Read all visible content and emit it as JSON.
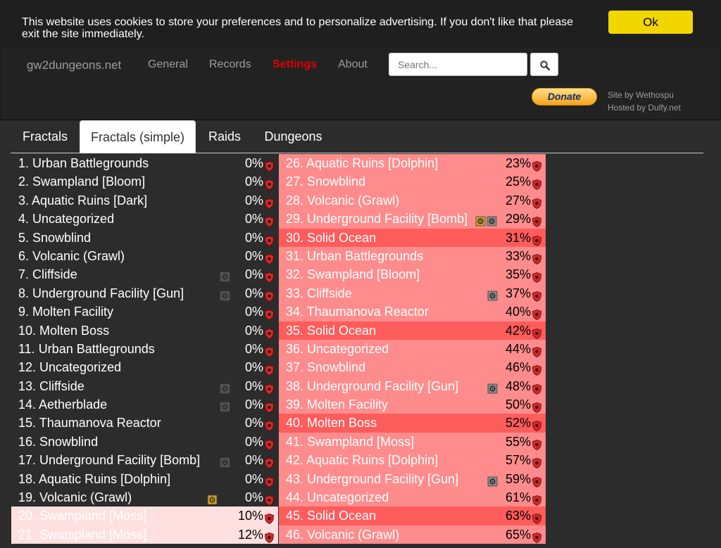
{
  "cookie": {
    "message": "This website uses cookies to store your preferences and to personalize advertising. If you don't like that please exit the site immediately.",
    "ok_label": "Ok"
  },
  "nav": {
    "brand": "gw2dungeons.net",
    "links": [
      "General",
      "Records",
      "Settings",
      "About"
    ],
    "active_link": "Settings",
    "search_placeholder": "Search...",
    "donate_label": "Donate",
    "credit_site": "Site by Wethospu",
    "credit_host": "Hosted by Dulfy.net"
  },
  "tabs": [
    "Fractals",
    "Fractals (simple)",
    "Raids",
    "Dungeons"
  ],
  "active_tab": "Fractals (simple)",
  "colors": {
    "dark_row": "#2c2c2c",
    "light_row": "#ff8c8c",
    "highlight_row": "#ff5c5c",
    "pale_row": "#ffe0e0",
    "shield": "#d42a2a"
  },
  "left_column": [
    {
      "name": "1. Urban Battlegrounds",
      "pct": "0%",
      "style": "dark",
      "icon": ""
    },
    {
      "name": "2. Swampland [Bloom]",
      "pct": "0%",
      "style": "dark",
      "icon": ""
    },
    {
      "name": "3. Aquatic Ruins [Dark]",
      "pct": "0%",
      "style": "dark",
      "icon": ""
    },
    {
      "name": "4. Uncategorized",
      "pct": "0%",
      "style": "dark",
      "icon": ""
    },
    {
      "name": "5. Snowblind",
      "pct": "0%",
      "style": "dark",
      "icon": ""
    },
    {
      "name": "6. Volcanic (Grawl)",
      "pct": "0%",
      "style": "dark",
      "icon": ""
    },
    {
      "name": "7. Cliffside",
      "pct": "0%",
      "style": "dark",
      "icon": "gear-icon"
    },
    {
      "name": "8. Underground Facility [Gun]",
      "pct": "0%",
      "style": "dark",
      "icon": "gear-icon"
    },
    {
      "name": "9. Molten Facility",
      "pct": "0%",
      "style": "dark",
      "icon": ""
    },
    {
      "name": "10. Molten Boss",
      "pct": "0%",
      "style": "dark",
      "icon": ""
    },
    {
      "name": "11. Urban Battlegrounds",
      "pct": "0%",
      "style": "dark",
      "icon": ""
    },
    {
      "name": "12. Uncategorized",
      "pct": "0%",
      "style": "dark",
      "icon": ""
    },
    {
      "name": "13. Cliffside",
      "pct": "0%",
      "style": "dark",
      "icon": "gear-icon"
    },
    {
      "name": "14. Aetherblade",
      "pct": "0%",
      "style": "dark",
      "icon": "gear-icon"
    },
    {
      "name": "15. Thaumanova Reactor",
      "pct": "0%",
      "style": "dark",
      "icon": ""
    },
    {
      "name": "16. Snowblind",
      "pct": "0%",
      "style": "dark",
      "icon": ""
    },
    {
      "name": "17. Underground Facility [Bomb]",
      "pct": "0%",
      "style": "dark",
      "icon": "gear-icon"
    },
    {
      "name": "18. Aquatic Ruins [Dolphin]",
      "pct": "0%",
      "style": "dark",
      "icon": ""
    },
    {
      "name": "19. Volcanic (Grawl)",
      "pct": "0%",
      "style": "dark",
      "icon": "gold-icon"
    },
    {
      "name": "20. Swampland [Moss]",
      "pct": "10%",
      "style": "pale",
      "icon": ""
    },
    {
      "name": "21. Swampland [Moss]",
      "pct": "12%",
      "style": "pale",
      "icon": ""
    }
  ],
  "right_column": [
    {
      "name": "26. Aquatic Ruins [Dolphin]",
      "pct": "23%",
      "style": "light",
      "icon": ""
    },
    {
      "name": "27. Snowblind",
      "pct": "25%",
      "style": "light",
      "icon": ""
    },
    {
      "name": "28. Volcanic (Grawl)",
      "pct": "27%",
      "style": "light",
      "icon": ""
    },
    {
      "name": "29. Underground Facility [Bomb]",
      "pct": "29%",
      "style": "light",
      "icon": "gold-gear-icon"
    },
    {
      "name": "30. Solid Ocean",
      "pct": "31%",
      "style": "highlight",
      "icon": ""
    },
    {
      "name": "31. Urban Battlegrounds",
      "pct": "33%",
      "style": "light",
      "icon": ""
    },
    {
      "name": "32. Swampland [Bloom]",
      "pct": "35%",
      "style": "light",
      "icon": ""
    },
    {
      "name": "33. Cliffside",
      "pct": "37%",
      "style": "light",
      "icon": "gear-icon"
    },
    {
      "name": "34. Thaumanova Reactor",
      "pct": "40%",
      "style": "light",
      "icon": ""
    },
    {
      "name": "35. Solid Ocean",
      "pct": "42%",
      "style": "highlight",
      "icon": ""
    },
    {
      "name": "36. Uncategorized",
      "pct": "44%",
      "style": "light",
      "icon": ""
    },
    {
      "name": "37. Snowblind",
      "pct": "46%",
      "style": "light",
      "icon": ""
    },
    {
      "name": "38. Underground Facility [Gun]",
      "pct": "48%",
      "style": "light",
      "icon": "gear-icon"
    },
    {
      "name": "39. Molten Facility",
      "pct": "50%",
      "style": "light",
      "icon": ""
    },
    {
      "name": "40. Molten Boss",
      "pct": "52%",
      "style": "highlight",
      "icon": ""
    },
    {
      "name": "41. Swampland [Moss]",
      "pct": "55%",
      "style": "light",
      "icon": ""
    },
    {
      "name": "42. Aquatic Ruins [Dolphin]",
      "pct": "57%",
      "style": "light",
      "icon": ""
    },
    {
      "name": "43. Underground Facility [Gun]",
      "pct": "59%",
      "style": "light",
      "icon": "gear-icon"
    },
    {
      "name": "44. Uncategorized",
      "pct": "61%",
      "style": "light",
      "icon": ""
    },
    {
      "name": "45. Solid Ocean",
      "pct": "63%",
      "style": "highlight",
      "icon": ""
    },
    {
      "name": "46. Volcanic (Grawl)",
      "pct": "65%",
      "style": "light",
      "icon": ""
    }
  ]
}
